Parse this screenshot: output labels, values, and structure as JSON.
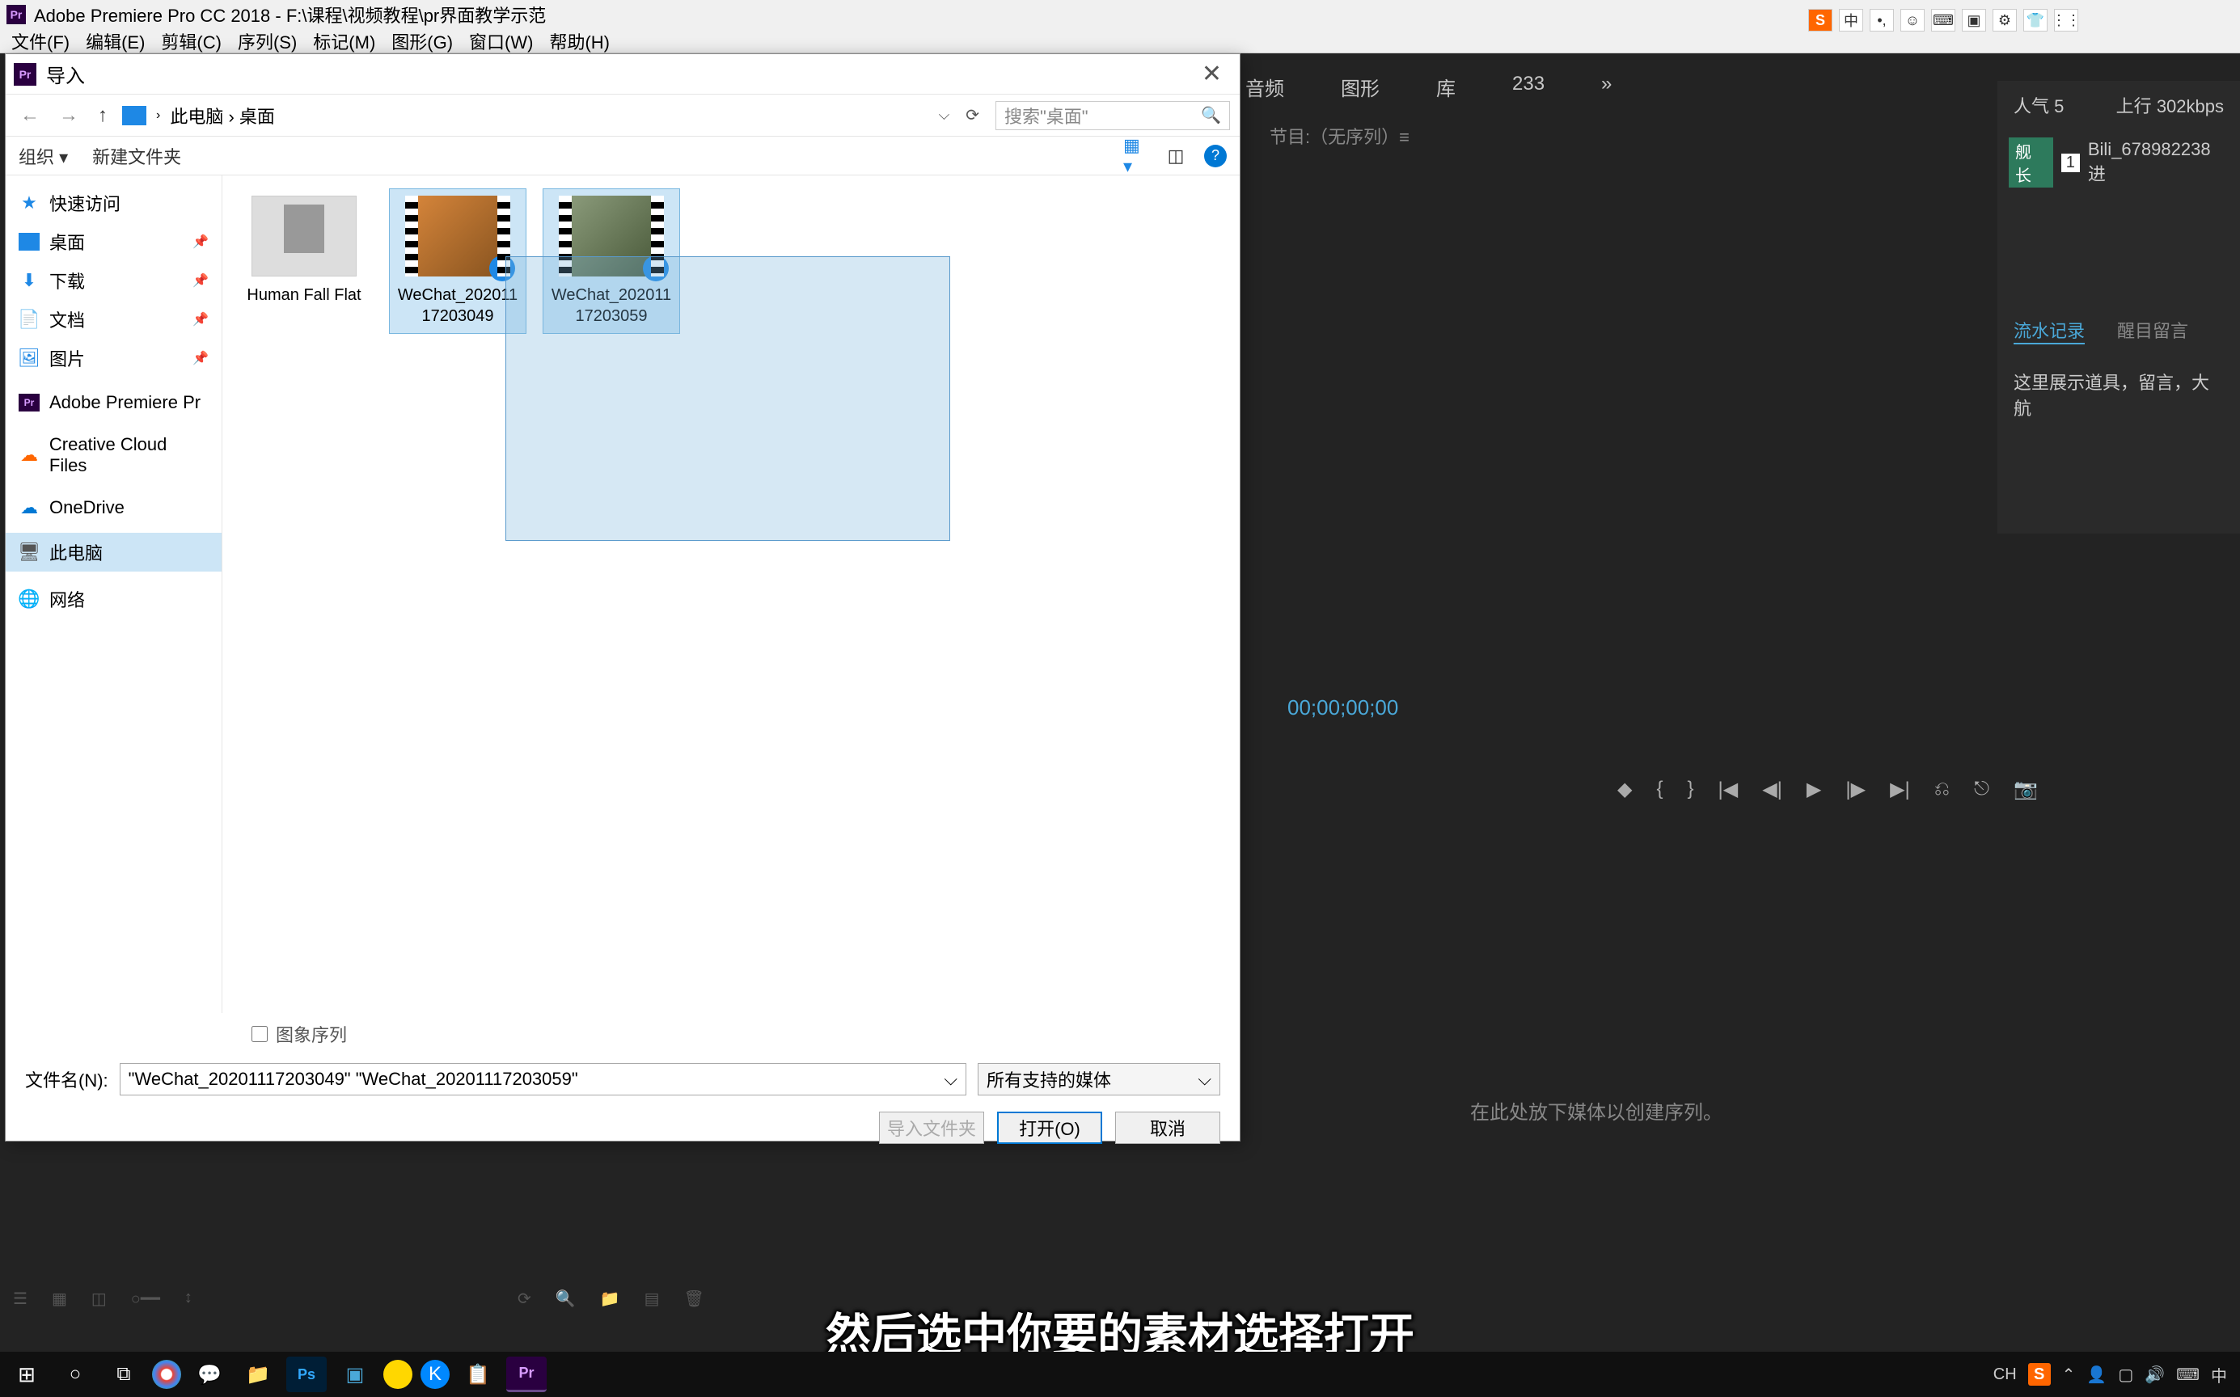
{
  "premiere": {
    "title": "Adobe Premiere Pro CC 2018 - F:\\课程\\视频教程\\pr界面教学示范",
    "menus": [
      "文件(F)",
      "编辑(E)",
      "剪辑(C)",
      "序列(S)",
      "标记(M)",
      "图形(G)",
      "窗口(W)",
      "帮助(H)"
    ],
    "tabs": [
      "音频",
      "图形",
      "库",
      "»"
    ],
    "tab_num": "233",
    "project_label": "节目:（无序列）≡",
    "timecode": "00;00;00;00",
    "timeline_msg": "在此处放下媒体以创建序列。"
  },
  "ime": {
    "items": [
      "S",
      "中",
      "•,",
      "☺",
      "⌨",
      "▣",
      "⚙",
      "👕",
      "⋮⋮"
    ]
  },
  "right_panel": {
    "popularity_label": "人气",
    "popularity_value": "5",
    "uplink_label": "上行",
    "uplink_value": "302kbps",
    "badge": "舰长",
    "rank": "1",
    "username": "Bili_678982238 进",
    "tab_active": "流水记录",
    "tab_other": "醒目留言",
    "msg": "这里展示道具，留言，大航"
  },
  "dialog": {
    "title": "导入",
    "path_parts": [
      "此电脑",
      "桌面"
    ],
    "search_placeholder": "搜索\"桌面\"",
    "organize": "组织 ▾",
    "new_folder": "新建文件夹",
    "sidebar": [
      {
        "icon": "star",
        "label": "快速访问",
        "pin": false
      },
      {
        "icon": "desktop",
        "label": "桌面",
        "pin": true
      },
      {
        "icon": "download",
        "label": "下载",
        "pin": true
      },
      {
        "icon": "doc",
        "label": "文档",
        "pin": true
      },
      {
        "icon": "pic",
        "label": "图片",
        "pin": true
      },
      {
        "icon": "pr",
        "label": "Adobe Premiere Pr",
        "pin": false
      },
      {
        "icon": "cc",
        "label": "Creative Cloud Files",
        "pin": false
      },
      {
        "icon": "od",
        "label": "OneDrive",
        "pin": false
      },
      {
        "icon": "pc",
        "label": "此电脑",
        "pin": false,
        "selected": true
      },
      {
        "icon": "net",
        "label": "网络",
        "pin": false
      }
    ],
    "files": [
      {
        "name": "Human Fall Flat",
        "type": "folder",
        "selected": false
      },
      {
        "name": "WeChat_20201117203049",
        "type": "video1",
        "selected": true
      },
      {
        "name": "WeChat_20201117203059",
        "type": "video2",
        "selected": true
      }
    ],
    "checkbox_label": "图象序列",
    "filename_label": "文件名(N):",
    "filename_value": "\"WeChat_20201117203049\" \"WeChat_20201117203059\"",
    "filter": "所有支持的媒体",
    "btn_import_folder": "导入文件夹",
    "btn_open": "打开(O)",
    "btn_cancel": "取消"
  },
  "caption": "然后选中你要的素材选择打开",
  "systray": {
    "lang": "CH"
  }
}
